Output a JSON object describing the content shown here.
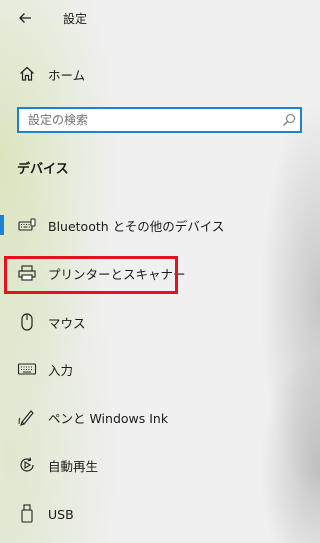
{
  "header": {
    "title": "設定"
  },
  "nav_home": {
    "label": "ホーム",
    "icon": "home-icon"
  },
  "search": {
    "placeholder": "設定の検索"
  },
  "section": {
    "title": "デバイス"
  },
  "items": [
    {
      "label": "Bluetooth とその他のデバイス",
      "icon": "bluetooth-keyboard-icon",
      "selected": true
    },
    {
      "label": "プリンターとスキャナー",
      "icon": "printer-icon",
      "selected": false,
      "highlighted": true
    },
    {
      "label": "マウス",
      "icon": "mouse-icon",
      "selected": false
    },
    {
      "label": "入力",
      "icon": "keyboard-icon",
      "selected": false
    },
    {
      "label": "ペンと Windows Ink",
      "icon": "pen-icon",
      "selected": false
    },
    {
      "label": "自動再生",
      "icon": "autoplay-icon",
      "selected": false
    },
    {
      "label": "USB",
      "icon": "usb-icon",
      "selected": false
    }
  ],
  "colors": {
    "accent": "#1e82d2",
    "highlight": "#e5121b"
  }
}
